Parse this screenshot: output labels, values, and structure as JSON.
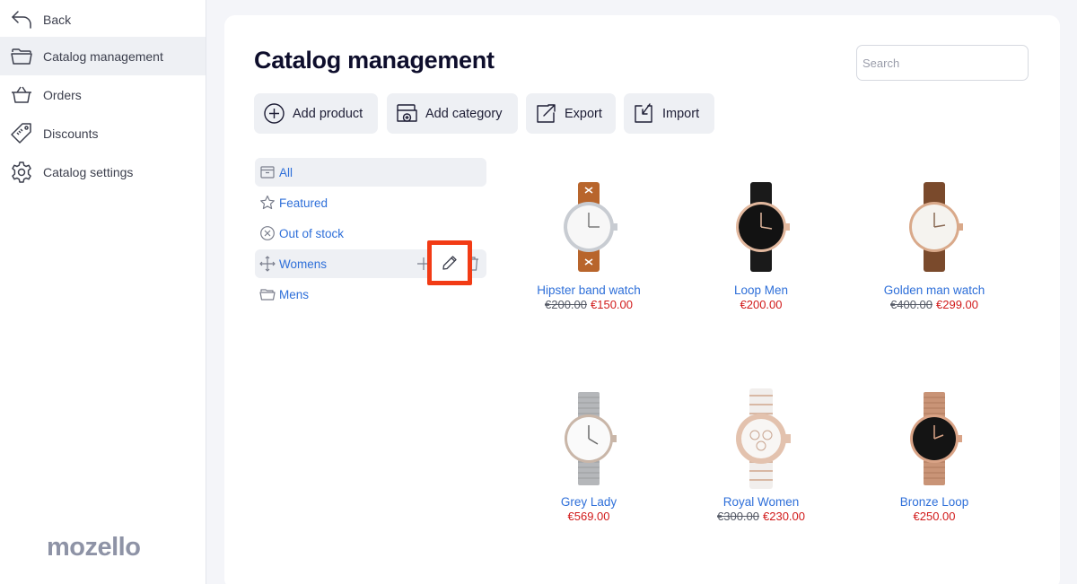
{
  "colors": {
    "accent": "#2e6fd9",
    "price_red": "#d11a1a",
    "highlight": "#f23b15",
    "sidebar_active": "#eef0f4"
  },
  "sidebar": {
    "items": [
      {
        "label": "Back",
        "icon": "back-arrow-icon"
      },
      {
        "label": "Catalog management",
        "icon": "folder-icon"
      },
      {
        "label": "Orders",
        "icon": "basket-icon"
      },
      {
        "label": "Discounts",
        "icon": "price-tag-icon"
      },
      {
        "label": "Catalog settings",
        "icon": "gear-icon"
      }
    ],
    "logo": "mozello"
  },
  "main": {
    "title": "Catalog management",
    "search_placeholder": "Search",
    "toolbar": [
      {
        "label": "Add product",
        "icon": "plus-circle-icon"
      },
      {
        "label": "Add category",
        "icon": "add-folder-icon"
      },
      {
        "label": "Export",
        "icon": "export-icon"
      },
      {
        "label": "Import",
        "icon": "import-icon"
      }
    ],
    "categories": [
      {
        "label": "All",
        "icon": "box-icon"
      },
      {
        "label": "Featured",
        "icon": "star-icon"
      },
      {
        "label": "Out of stock",
        "icon": "x-circle-icon"
      },
      {
        "label": "Womens",
        "icon": "move-icon"
      },
      {
        "label": "Mens",
        "icon": "folder-icon"
      }
    ],
    "products": [
      {
        "name": "Hipster band watch",
        "old_price": "€200.00",
        "price": "€150.00"
      },
      {
        "name": "Loop Men",
        "old_price": "",
        "price": "€200.00"
      },
      {
        "name": "Golden man watch",
        "old_price": "€400.00",
        "price": "€299.00"
      },
      {
        "name": "Grey Lady",
        "old_price": "",
        "price": "€569.00"
      },
      {
        "name": "Royal Women",
        "old_price": "€300.00",
        "price": "€230.00"
      },
      {
        "name": "Bronze Loop",
        "old_price": "",
        "price": "€250.00"
      }
    ]
  }
}
